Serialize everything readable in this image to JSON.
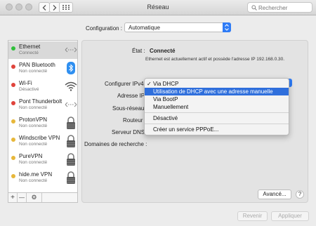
{
  "window": {
    "title": "Réseau",
    "search_placeholder": "Rechercher"
  },
  "configuration": {
    "label": "Configuration :",
    "value": "Automatique"
  },
  "sidebar": {
    "items": [
      {
        "name": "Ethernet",
        "status": "Connecté",
        "dot_color": "#2fbf3a",
        "icon": "ethernet-arrows-icon"
      },
      {
        "name": "PAN Bluetooth",
        "status": "Non connecté",
        "dot_color": "#e0443c",
        "icon": "bluetooth-icon"
      },
      {
        "name": "Wi-Fi",
        "status": "Désactivé",
        "dot_color": "#e0443c",
        "icon": "wifi-icon"
      },
      {
        "name": "Pont Thunderbolt",
        "status": "Non connecté",
        "dot_color": "#e0443c",
        "icon": "ethernet-arrows-icon"
      },
      {
        "name": "ProtonVPN",
        "status": "Non connecté",
        "dot_color": "#e7b73a",
        "icon": "lock-icon"
      },
      {
        "name": "Windscribe VPN",
        "status": "Non connecté",
        "dot_color": "#e7b73a",
        "icon": "lock-icon"
      },
      {
        "name": "PureVPN",
        "status": "Non connecté",
        "dot_color": "#e7b73a",
        "icon": "lock-icon"
      },
      {
        "name": "hide.me VPN",
        "status": "Non connecté",
        "dot_color": "#e7b73a",
        "icon": "lock-icon"
      }
    ],
    "tools": {
      "add": "+",
      "remove": "—",
      "action": "⚙"
    }
  },
  "details": {
    "status_label": "État :",
    "status_value": "Connecté",
    "status_description": "Ethernet est actuellement actif et possède l'adresse IP 192.168.0.30.",
    "configure_ipv4_label": "Configurer IPv4",
    "ip_address_label": "Adresse IP",
    "subnet_label": "Sous-réseau",
    "router_label": "Routeur",
    "dns_label": "Serveur DNS",
    "search_domains_label": "Domaines de recherche :"
  },
  "ipv4_menu": {
    "selected": "Via DHCP",
    "items": [
      "Via DHCP",
      "Utilisation de DHCP avec une adresse manuelle",
      "Via BootP",
      "Manuellement",
      "Désactivé",
      "Créer un service PPPoE..."
    ],
    "highlighted": "Utilisation de DHCP avec une adresse manuelle"
  },
  "buttons": {
    "advanced": "Avancé...",
    "help": "?",
    "revert": "Revenir",
    "apply": "Appliquer"
  },
  "colors": {
    "accent": "#2f7cf6",
    "menu_highlight": "#2f6fdc"
  }
}
